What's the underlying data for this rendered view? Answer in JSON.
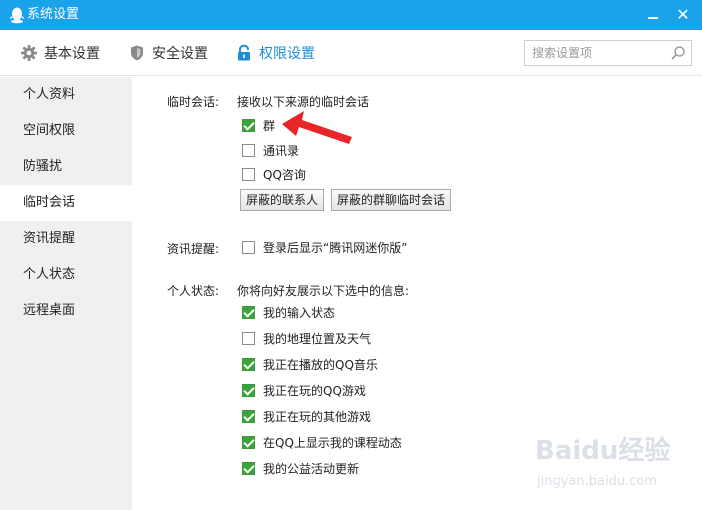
{
  "window": {
    "title": "系统设置",
    "accent_color": "#1aa3ea",
    "close_glyph": "✕"
  },
  "tabs": [
    {
      "label": "基本设置",
      "icon": "gear-icon",
      "active": false
    },
    {
      "label": "安全设置",
      "icon": "shield-icon",
      "active": false
    },
    {
      "label": "权限设置",
      "icon": "lock-icon",
      "active": true
    }
  ],
  "search": {
    "placeholder": "搜索设置项",
    "value": ""
  },
  "sidebar": {
    "items": [
      {
        "label": "个人资料",
        "active": false
      },
      {
        "label": "空间权限",
        "active": false
      },
      {
        "label": "防骚扰",
        "active": false
      },
      {
        "label": "临时会话",
        "active": true
      },
      {
        "label": "资讯提醒",
        "active": false
      },
      {
        "label": "个人状态",
        "active": false
      },
      {
        "label": "远程桌面",
        "active": false
      }
    ]
  },
  "temp_session": {
    "label": "临时会话:",
    "desc": "接收以下来源的临时会话",
    "options": [
      {
        "label": "群",
        "checked": true
      },
      {
        "label": "通讯录",
        "checked": false
      },
      {
        "label": "QQ咨询",
        "checked": false
      }
    ],
    "buttons": {
      "blocked_contacts": "屏蔽的联系人",
      "blocked_group_temp": "屏蔽的群聊临时会话"
    }
  },
  "news_reminder": {
    "label": "资讯提醒:",
    "option": {
      "label": "登录后显示“腾讯网迷你版”",
      "checked": false
    }
  },
  "personal_status": {
    "label": "个人状态:",
    "desc": "你将向好友展示以下选中的信息:",
    "options": [
      {
        "label": "我的输入状态",
        "checked": true
      },
      {
        "label": "我的地理位置及天气",
        "checked": false
      },
      {
        "label": "我正在播放的QQ音乐",
        "checked": true
      },
      {
        "label": "我正在玩的QQ游戏",
        "checked": true
      },
      {
        "label": "我正在玩的其他游戏",
        "checked": true
      },
      {
        "label": "在QQ上显示我的课程动态",
        "checked": true
      },
      {
        "label": "我的公益活动更新",
        "checked": true
      }
    ]
  },
  "annotation": {
    "arrow_color": "#e8262a"
  },
  "watermark": {
    "main": "Baidu经验",
    "sub": "jingyan.baidu.com"
  }
}
